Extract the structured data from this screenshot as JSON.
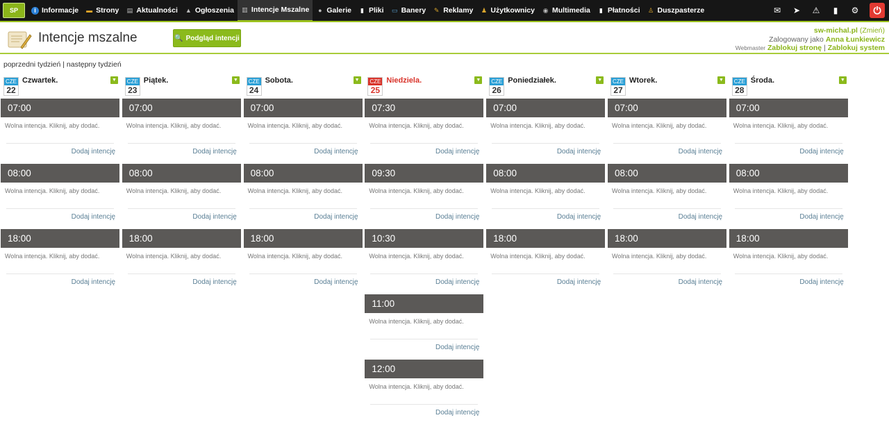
{
  "app": {
    "logo": "SP"
  },
  "nav": {
    "items": [
      {
        "label": "Informacje",
        "icon": "info-icon",
        "color": "#2a7fd6"
      },
      {
        "label": "Strony",
        "icon": "folder-icon",
        "color": "#e7a829"
      },
      {
        "label": "Aktualności",
        "icon": "news-icon",
        "color": "#bbbbbb"
      },
      {
        "label": "Ogłoszenia",
        "icon": "pin-icon",
        "color": "#bbbbbb"
      },
      {
        "label": "Intencje Mszalne",
        "icon": "book-icon",
        "color": "#bbbbbb",
        "active": true
      },
      {
        "label": "Galerie",
        "icon": "camera-icon",
        "color": "#bbbbbb"
      },
      {
        "label": "Pliki",
        "icon": "file-icon",
        "color": "#ffffff"
      },
      {
        "label": "Banery",
        "icon": "banner-icon",
        "color": "#5aa3d6"
      },
      {
        "label": "Reklamy",
        "icon": "ads-icon",
        "color": "#d9a52c"
      },
      {
        "label": "Użytkownicy",
        "icon": "user-icon",
        "color": "#d9a52c"
      },
      {
        "label": "Multimedia",
        "icon": "media-icon",
        "color": "#bbbbbb"
      },
      {
        "label": "Płatności",
        "icon": "payment-icon",
        "color": "#ffffff"
      },
      {
        "label": "Duszpasterze",
        "icon": "priest-icon",
        "color": "#d9a52c"
      }
    ],
    "right_icons": [
      "mail-icon",
      "send-icon",
      "warning-icon",
      "note-icon",
      "gear-icon",
      "power-icon"
    ]
  },
  "header": {
    "title": "Intencje mszalne",
    "preview_button": "Podgląd intencji",
    "site": "sw-michal.pl",
    "change": "(Zmień)",
    "logged_as_label": "Zalogowany jako",
    "user": "Anna Łunkiewicz",
    "role": "Webmaster",
    "block_page": "Zablokuj stronę",
    "separator": "|",
    "block_system": "Zablokuj system"
  },
  "weeknav": {
    "prev": "poprzedni tydzień",
    "sep": "|",
    "next": "następny tydzień"
  },
  "slot_text": {
    "free": "Wolna intencja. Kliknij, aby dodać.",
    "add": "Dodaj intencję"
  },
  "days": [
    {
      "month": "CZE",
      "day": "22",
      "name": "Czwartek.",
      "sunday": false,
      "slots": [
        "07:00",
        "08:00",
        "18:00"
      ]
    },
    {
      "month": "CZE",
      "day": "23",
      "name": "Piątek.",
      "sunday": false,
      "slots": [
        "07:00",
        "08:00",
        "18:00"
      ]
    },
    {
      "month": "CZE",
      "day": "24",
      "name": "Sobota.",
      "sunday": false,
      "slots": [
        "07:00",
        "08:00",
        "18:00"
      ]
    },
    {
      "month": "CZE",
      "day": "25",
      "name": "Niedziela.",
      "sunday": true,
      "slots": [
        "07:30",
        "09:30",
        "10:30",
        "11:00",
        "12:00"
      ]
    },
    {
      "month": "CZE",
      "day": "26",
      "name": "Poniedziałek.",
      "sunday": false,
      "slots": [
        "07:00",
        "08:00",
        "18:00"
      ]
    },
    {
      "month": "CZE",
      "day": "27",
      "name": "Wtorek.",
      "sunday": false,
      "slots": [
        "07:00",
        "08:00",
        "18:00"
      ]
    },
    {
      "month": "CZE",
      "day": "28",
      "name": "Środa.",
      "sunday": false,
      "slots": [
        "07:00",
        "08:00",
        "18:00"
      ]
    }
  ],
  "colors": {
    "accent": "#8bba1c",
    "slot_bg": "#5b5957",
    "sunday": "#d9342b",
    "calendar_month": "#2a9fd6"
  }
}
